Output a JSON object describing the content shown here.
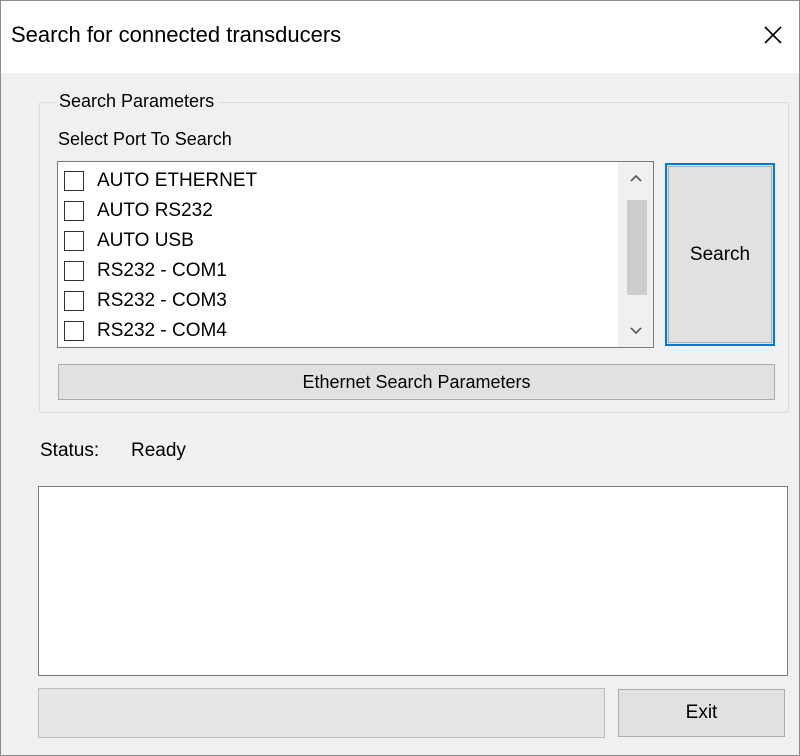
{
  "window": {
    "title": "Search for connected transducers",
    "close_icon": "close-icon"
  },
  "search_parameters": {
    "group_title": "Search Parameters",
    "port_label": "Select Port To Search",
    "ports": [
      {
        "label": "AUTO ETHERNET",
        "checked": false
      },
      {
        "label": "AUTO RS232",
        "checked": false
      },
      {
        "label": "AUTO USB",
        "checked": false
      },
      {
        "label": "RS232 - COM1",
        "checked": false
      },
      {
        "label": "RS232 - COM3",
        "checked": false
      },
      {
        "label": "RS232 - COM4",
        "checked": false
      }
    ],
    "scroll_up_icon": "chevron-up-icon",
    "scroll_down_icon": "chevron-down-icon",
    "search_button": "Search",
    "ethernet_button": "Ethernet Search Parameters"
  },
  "status": {
    "label": "Status:",
    "value": "Ready"
  },
  "output": {
    "text": ""
  },
  "progress": {
    "value": 0
  },
  "footer": {
    "exit_button": "Exit"
  },
  "colors": {
    "focus_border": "#0078d7",
    "button_face": "#e1e1e1",
    "window_bg": "#f0f0f0"
  }
}
